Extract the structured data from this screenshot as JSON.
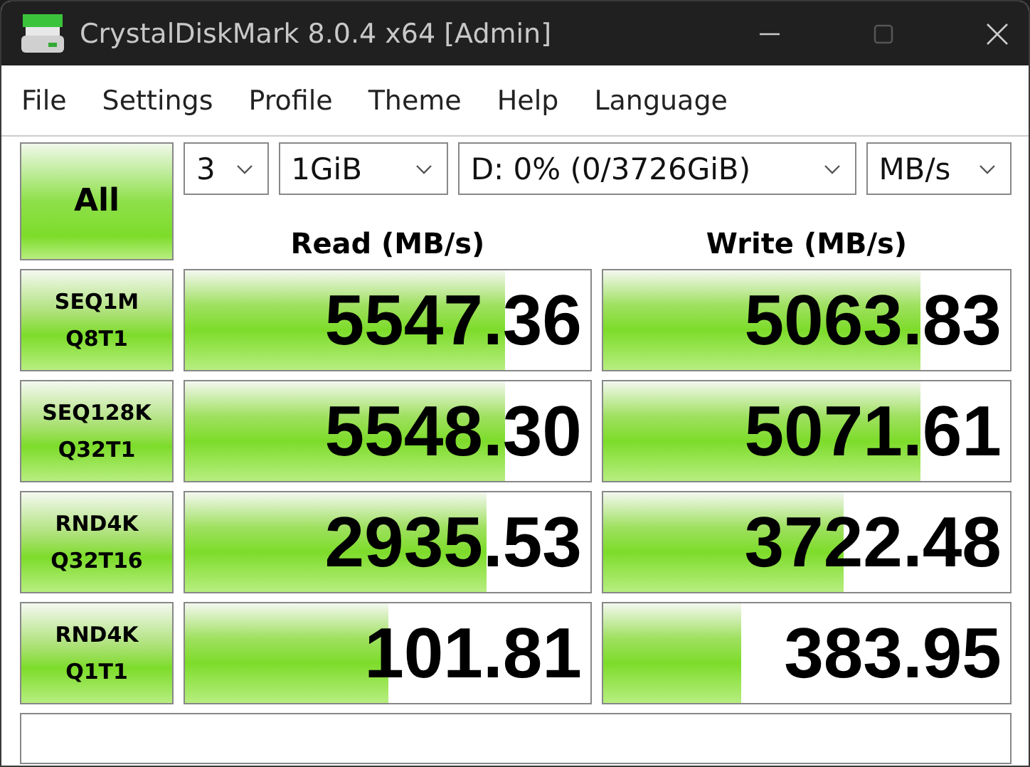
{
  "window": {
    "title": "CrystalDiskMark 8.0.4 x64 [Admin]"
  },
  "menu": [
    "File",
    "Settings",
    "Profile",
    "Theme",
    "Help",
    "Language"
  ],
  "all_button": "All",
  "selects": [
    {
      "value": "3"
    },
    {
      "value": "1GiB"
    },
    {
      "value": "D: 0% (0/3726GiB)"
    },
    {
      "value": "MB/s"
    }
  ],
  "columns": [
    "Read (MB/s)",
    "Write (MB/s)"
  ],
  "rows": [
    {
      "test": "SEQ1M",
      "params": "Q8T1",
      "read": {
        "value": "5547.36",
        "level": 0.79
      },
      "write": {
        "value": "5063.83",
        "level": 0.78
      }
    },
    {
      "test": "SEQ128K",
      "params": "Q32T1",
      "read": {
        "value": "5548.30",
        "level": 0.79
      },
      "write": {
        "value": "5071.61",
        "level": 0.78
      }
    },
    {
      "test": "RND4K",
      "params": "Q32T16",
      "read": {
        "value": "2935.53",
        "level": 0.745
      },
      "write": {
        "value": "3722.48",
        "level": 0.59
      }
    },
    {
      "test": "RND4K",
      "params": "Q1T1",
      "read": {
        "value": "101.81",
        "level": 0.5
      },
      "write": {
        "value": "383.95",
        "level": 0.34
      }
    }
  ]
}
